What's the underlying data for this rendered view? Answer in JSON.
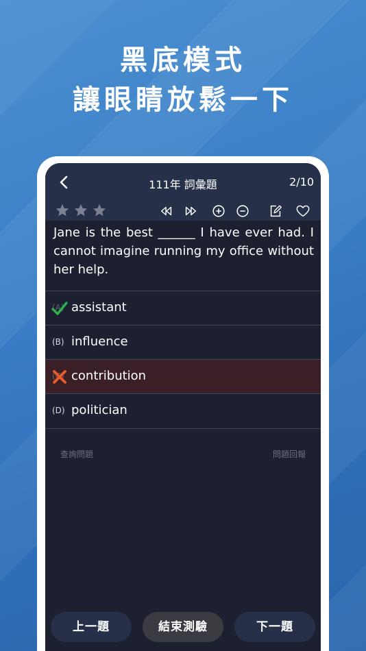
{
  "promo": {
    "line1": "黑底模式",
    "line2": "讓眼睛放鬆一下"
  },
  "navbar": {
    "title": "111年 詞彙題",
    "counter": "2/10",
    "back_icon": "chevron-left-icon"
  },
  "toolbar": {
    "rating_stars": 3,
    "icons": [
      "rewind-icon",
      "fast-forward-icon",
      "zoom-in-icon",
      "zoom-out-icon",
      "edit-note-icon",
      "heart-icon"
    ]
  },
  "question": {
    "text": "Jane is the best ______ I have ever had. I cannot imagine running my office without her help."
  },
  "options": [
    {
      "letter": "(A)",
      "text": "assistant",
      "state": "correct"
    },
    {
      "letter": "(B)",
      "text": "influence",
      "state": "none"
    },
    {
      "letter": "(C)",
      "text": "contribution",
      "state": "wrong"
    },
    {
      "letter": "(D)",
      "text": "politician",
      "state": "none"
    }
  ],
  "links": {
    "query": "查詢問題",
    "report": "問題回報"
  },
  "buttons": {
    "prev": "上一題",
    "end": "結束測驗",
    "next": "下一題"
  },
  "colors": {
    "background": "#3a7fc7",
    "screen": "#1c2030",
    "navbar": "#263149",
    "correct": "#2bb24c",
    "wrong": "#e85c2c",
    "wrong_row": "#3a1f27"
  }
}
